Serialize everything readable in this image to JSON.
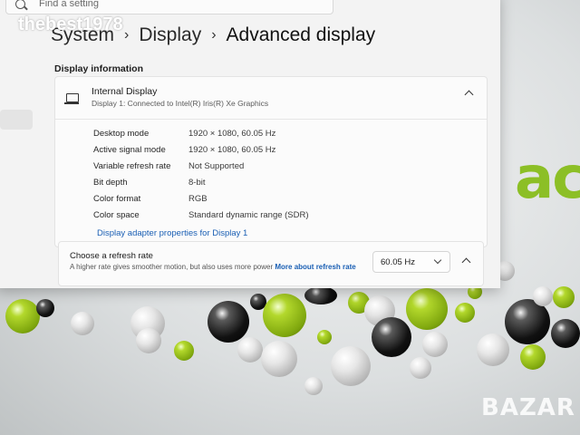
{
  "overlay": {
    "username": "thebest1978"
  },
  "search": {
    "placeholder": "Find a setting"
  },
  "breadcrumb": {
    "items": [
      "System",
      "Display",
      "Advanced display"
    ]
  },
  "display_info": {
    "section_title": "Display information",
    "card": {
      "title": "Internal Display",
      "subtitle": "Display 1: Connected to Intel(R) Iris(R) Xe Graphics",
      "rows": [
        {
          "label": "Desktop mode",
          "value": "1920 × 1080, 60.05 Hz"
        },
        {
          "label": "Active signal mode",
          "value": "1920 × 1080, 60.05 Hz"
        },
        {
          "label": "Variable refresh rate",
          "value": "Not Supported"
        },
        {
          "label": "Bit depth",
          "value": "8-bit"
        },
        {
          "label": "Color format",
          "value": "RGB"
        },
        {
          "label": "Color space",
          "value": "Standard dynamic range (SDR)"
        }
      ],
      "adapter_link": "Display adapter properties for Display 1"
    }
  },
  "refresh_rate": {
    "title": "Choose a refresh rate",
    "description": "A higher rate gives smoother motion, but also uses more power",
    "link": "More about refresh rate",
    "selected": "60.05 Hz"
  },
  "wallpaper": {
    "brand": "acer",
    "watermark": "BAZAR"
  },
  "colors": {
    "accent_link": "#1a5fb4",
    "acer_green": "#8cbf26"
  }
}
